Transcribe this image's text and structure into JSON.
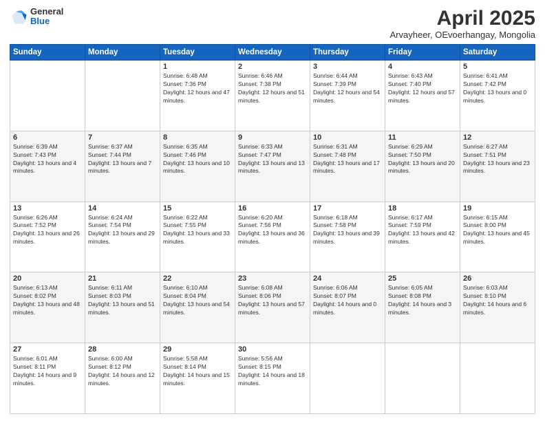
{
  "header": {
    "logo_general": "General",
    "logo_blue": "Blue",
    "month_title": "April 2025",
    "subtitle": "Arvayheer, OEvoerhangay, Mongolia"
  },
  "weekdays": [
    "Sunday",
    "Monday",
    "Tuesday",
    "Wednesday",
    "Thursday",
    "Friday",
    "Saturday"
  ],
  "weeks": [
    [
      {
        "day": "",
        "info": ""
      },
      {
        "day": "",
        "info": ""
      },
      {
        "day": "1",
        "info": "Sunrise: 6:48 AM\nSunset: 7:36 PM\nDaylight: 12 hours and 47 minutes."
      },
      {
        "day": "2",
        "info": "Sunrise: 6:46 AM\nSunset: 7:38 PM\nDaylight: 12 hours and 51 minutes."
      },
      {
        "day": "3",
        "info": "Sunrise: 6:44 AM\nSunset: 7:39 PM\nDaylight: 12 hours and 54 minutes."
      },
      {
        "day": "4",
        "info": "Sunrise: 6:43 AM\nSunset: 7:40 PM\nDaylight: 12 hours and 57 minutes."
      },
      {
        "day": "5",
        "info": "Sunrise: 6:41 AM\nSunset: 7:42 PM\nDaylight: 13 hours and 0 minutes."
      }
    ],
    [
      {
        "day": "6",
        "info": "Sunrise: 6:39 AM\nSunset: 7:43 PM\nDaylight: 13 hours and 4 minutes."
      },
      {
        "day": "7",
        "info": "Sunrise: 6:37 AM\nSunset: 7:44 PM\nDaylight: 13 hours and 7 minutes."
      },
      {
        "day": "8",
        "info": "Sunrise: 6:35 AM\nSunset: 7:46 PM\nDaylight: 13 hours and 10 minutes."
      },
      {
        "day": "9",
        "info": "Sunrise: 6:33 AM\nSunset: 7:47 PM\nDaylight: 13 hours and 13 minutes."
      },
      {
        "day": "10",
        "info": "Sunrise: 6:31 AM\nSunset: 7:48 PM\nDaylight: 13 hours and 17 minutes."
      },
      {
        "day": "11",
        "info": "Sunrise: 6:29 AM\nSunset: 7:50 PM\nDaylight: 13 hours and 20 minutes."
      },
      {
        "day": "12",
        "info": "Sunrise: 6:27 AM\nSunset: 7:51 PM\nDaylight: 13 hours and 23 minutes."
      }
    ],
    [
      {
        "day": "13",
        "info": "Sunrise: 6:26 AM\nSunset: 7:52 PM\nDaylight: 13 hours and 26 minutes."
      },
      {
        "day": "14",
        "info": "Sunrise: 6:24 AM\nSunset: 7:54 PM\nDaylight: 13 hours and 29 minutes."
      },
      {
        "day": "15",
        "info": "Sunrise: 6:22 AM\nSunset: 7:55 PM\nDaylight: 13 hours and 33 minutes."
      },
      {
        "day": "16",
        "info": "Sunrise: 6:20 AM\nSunset: 7:56 PM\nDaylight: 13 hours and 36 minutes."
      },
      {
        "day": "17",
        "info": "Sunrise: 6:18 AM\nSunset: 7:58 PM\nDaylight: 13 hours and 39 minutes."
      },
      {
        "day": "18",
        "info": "Sunrise: 6:17 AM\nSunset: 7:59 PM\nDaylight: 13 hours and 42 minutes."
      },
      {
        "day": "19",
        "info": "Sunrise: 6:15 AM\nSunset: 8:00 PM\nDaylight: 13 hours and 45 minutes."
      }
    ],
    [
      {
        "day": "20",
        "info": "Sunrise: 6:13 AM\nSunset: 8:02 PM\nDaylight: 13 hours and 48 minutes."
      },
      {
        "day": "21",
        "info": "Sunrise: 6:11 AM\nSunset: 8:03 PM\nDaylight: 13 hours and 51 minutes."
      },
      {
        "day": "22",
        "info": "Sunrise: 6:10 AM\nSunset: 8:04 PM\nDaylight: 13 hours and 54 minutes."
      },
      {
        "day": "23",
        "info": "Sunrise: 6:08 AM\nSunset: 8:06 PM\nDaylight: 13 hours and 57 minutes."
      },
      {
        "day": "24",
        "info": "Sunrise: 6:06 AM\nSunset: 8:07 PM\nDaylight: 14 hours and 0 minutes."
      },
      {
        "day": "25",
        "info": "Sunrise: 6:05 AM\nSunset: 8:08 PM\nDaylight: 14 hours and 3 minutes."
      },
      {
        "day": "26",
        "info": "Sunrise: 6:03 AM\nSunset: 8:10 PM\nDaylight: 14 hours and 6 minutes."
      }
    ],
    [
      {
        "day": "27",
        "info": "Sunrise: 6:01 AM\nSunset: 8:11 PM\nDaylight: 14 hours and 9 minutes."
      },
      {
        "day": "28",
        "info": "Sunrise: 6:00 AM\nSunset: 8:12 PM\nDaylight: 14 hours and 12 minutes."
      },
      {
        "day": "29",
        "info": "Sunrise: 5:58 AM\nSunset: 8:14 PM\nDaylight: 14 hours and 15 minutes."
      },
      {
        "day": "30",
        "info": "Sunrise: 5:56 AM\nSunset: 8:15 PM\nDaylight: 14 hours and 18 minutes."
      },
      {
        "day": "",
        "info": ""
      },
      {
        "day": "",
        "info": ""
      },
      {
        "day": "",
        "info": ""
      }
    ]
  ]
}
